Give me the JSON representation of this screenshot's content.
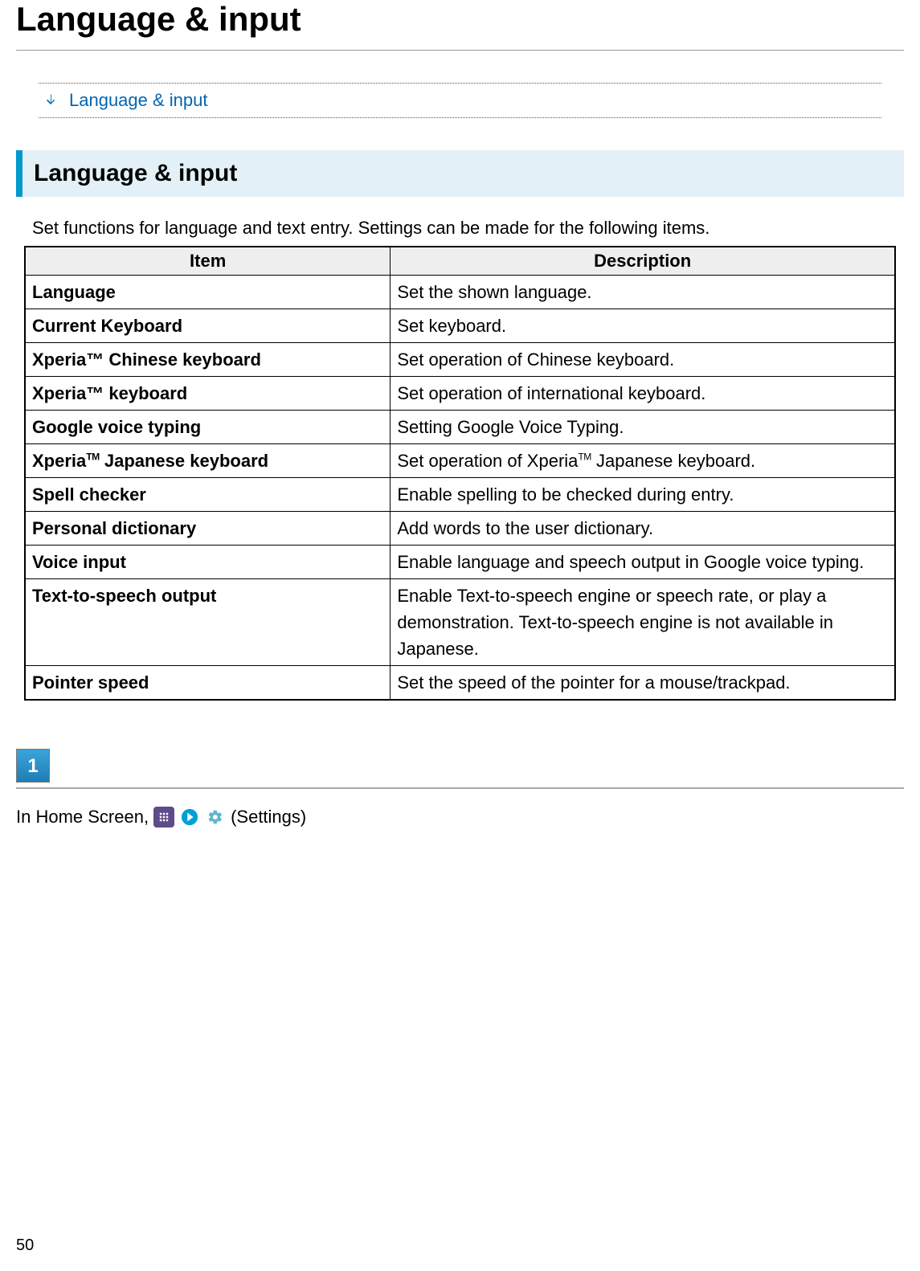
{
  "pageTitle": "Language & input",
  "toc": {
    "link": "Language & input"
  },
  "section": {
    "header": "Language & input",
    "intro": "Set functions for language and text entry. Settings can be made for the following items.",
    "tableHeaders": {
      "item": "Item",
      "description": "Description"
    },
    "rows": [
      {
        "item": "Language",
        "desc": "Set the shown language."
      },
      {
        "item": "Current Keyboard",
        "desc": "Set keyboard."
      },
      {
        "item": "Xperia™ Chinese keyboard",
        "desc": "Set operation of Chinese keyboard."
      },
      {
        "item": "Xperia™ keyboard",
        "desc": "Set operation of international keyboard."
      },
      {
        "item": "Google voice typing",
        "desc": "Setting Google Voice Typing."
      },
      {
        "item": "Xperia|TM| Japanese keyboard",
        "desc": "Set operation of Xperia|TM| Japanese keyboard."
      },
      {
        "item": "Spell checker",
        "desc": "Enable spelling to be checked during entry."
      },
      {
        "item": "Personal dictionary",
        "desc": "Add words to the user dictionary."
      },
      {
        "item": "Voice input",
        "desc": "Enable language and speech output in Google voice typing."
      },
      {
        "item": "Text-to-speech output",
        "desc": "Enable Text-to-speech engine or speech rate, or play a demonstration. Text-to-speech engine is not available in Japanese."
      },
      {
        "item": "Pointer speed",
        "desc": "Set the speed of the pointer for a mouse/trackpad."
      }
    ]
  },
  "step": {
    "number": "1",
    "prefix": "In Home Screen,",
    "suffix": "(Settings)"
  },
  "pageNumber": "50"
}
